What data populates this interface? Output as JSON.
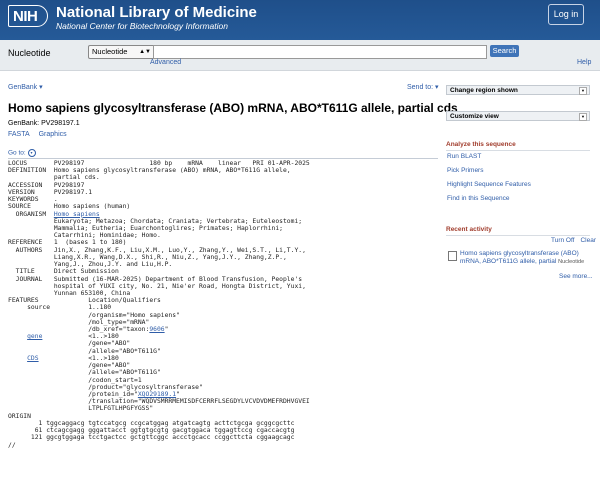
{
  "header": {
    "logo": "NIH",
    "title": "National Library of Medicine",
    "subtitle": "National Center for Biotechnology Information",
    "login_label": "Log in"
  },
  "search_bar": {
    "db_label": "Nucleotide",
    "db_selected": "Nucleotide",
    "query": "",
    "search_label": "Search",
    "advanced_label": "Advanced",
    "help_label": "Help"
  },
  "record": {
    "genbank_menu": "GenBank",
    "send_to": "Send to:",
    "title": "Homo sapiens glycosyltransferase (ABO) mRNA, ABO*T611G allele, partial cds",
    "accession_line": "GenBank: PV298197.1",
    "formats": [
      "FASTA",
      "Graphics"
    ],
    "goto_label": "Go to:"
  },
  "flatfile": [
    {
      "t": "LOCUS       PV298197                 180 bp    mRNA    linear   PRI 01-APR-2025"
    },
    {
      "t": "DEFINITION  Homo sapiens glycosyltransferase (ABO) mRNA, ABO*T611G allele,"
    },
    {
      "t": "            partial cds."
    },
    {
      "t": "ACCESSION   PV298197"
    },
    {
      "t": "VERSION     PV298197.1"
    },
    {
      "t": "KEYWORDS    ."
    },
    {
      "t": "SOURCE      Homo sapiens (human)"
    },
    {
      "t": "  ORGANISM  ",
      "lk": "Homo sapiens"
    },
    {
      "t": "            Eukaryota; Metazoa; Chordata; Craniata; Vertebrata; Euteleostomi;"
    },
    {
      "t": "            Mammalia; Eutheria; Euarchontoglires; Primates; Haplorrhini;"
    },
    {
      "t": "            Catarrhini; Hominidae; Homo."
    },
    {
      "t": "REFERENCE   1  (bases 1 to 180)"
    },
    {
      "t": "  AUTHORS   Jin,X., Zhang,K.F., Liu,X.M., Luo,Y., Zhang,Y., Wei,S.T., Li,T.Y.,"
    },
    {
      "t": "            Liang,X.R., Wang,D.X., Shi,R., Niu,Z., Yang,J.Y., Zhang,Z.P.,"
    },
    {
      "t": "            Yang,J., Zhou,J.Y. and Liu,H.P."
    },
    {
      "t": "  TITLE     Direct Submission"
    },
    {
      "t": "  JOURNAL   Submitted (16-MAR-2025) Department of Blood Transfusion, People's"
    },
    {
      "t": "            hospital of YUXI city, No. 21, Nie'er Road, Hongta District, Yuxi,"
    },
    {
      "t": "            Yunnan 653100, China"
    },
    {
      "t": "FEATURES             Location/Qualifiers"
    },
    {
      "t": "     source          1..180"
    },
    {
      "t": "                     /organism=\"Homo sapiens\""
    },
    {
      "t": "                     /mol_type=\"mRNA\""
    },
    {
      "t": "                     /db_xref=\"taxon:",
      "lk": "9606",
      "after": "\""
    },
    {
      "t": "     ",
      "lk": "gene",
      "after": "            <1..>180"
    },
    {
      "t": "                     /gene=\"ABO\""
    },
    {
      "t": "                     /allele=\"ABO*T611G\""
    },
    {
      "t": "     ",
      "lk": "CDS",
      "after": "             <1..>180"
    },
    {
      "t": "                     /gene=\"ABO\""
    },
    {
      "t": "                     /allele=\"ABO*T611G\""
    },
    {
      "t": "                     /codon_start=1"
    },
    {
      "t": "                     /product=\"glycosyltransferase\""
    },
    {
      "t": "                     /protein_id=\"",
      "lk": "XQO29189.1",
      "after": "\""
    },
    {
      "t": "                     /translation=\"WQDVSMRRMEMISDFCERRFLSEGDYLVCVDVDMEFRDHVGVEI"
    },
    {
      "t": "                     LTPLFGTLHPGFYGSS\""
    },
    {
      "t": "ORIGIN      "
    },
    {
      "t": "        1 tggcaggacg tgtccatgcg ccgcatggag atgatcagtg acttctgcga gcggcgcttc"
    },
    {
      "t": "       61 ctcagcgagg gggattacct ggtgtgcgtg gacgtggaca tggagttccg cgaccacgtg"
    },
    {
      "t": "      121 ggcgtggaga tcctgactcc gctgttcggc accctgcacc ccggcttcta cggaagcagc"
    },
    {
      "t": "//"
    }
  ],
  "sidebar": {
    "change_region": "Change region shown",
    "customize_view": "Customize view",
    "analyze_heading": "Analyze this sequence",
    "analyze_items": [
      "Run BLAST",
      "Pick Primers",
      "Highlight Sequence Features",
      "Find in this Sequence"
    ],
    "recent_heading": "Recent activity",
    "turn_off": "Turn Off",
    "clear": "Clear",
    "recent_item": "Homo sapiens glycosyltransferase (ABO) mRNA, ABO*T611G allele, partial",
    "recent_tag": "Nucleotide",
    "see_more": "See more..."
  }
}
